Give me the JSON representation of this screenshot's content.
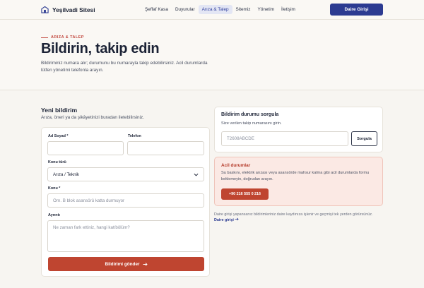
{
  "header": {
    "brand": "Yeşilvadi Sitesi",
    "nav": [
      {
        "label": "Şeffaf Kasa",
        "active": false
      },
      {
        "label": "Duyurular",
        "active": false
      },
      {
        "label": "Arıza & Talep",
        "active": true
      },
      {
        "label": "Sitemiz",
        "active": false
      },
      {
        "label": "Yönetim",
        "active": false
      },
      {
        "label": "İletişim",
        "active": false
      }
    ],
    "login_label": "Daire Girişi"
  },
  "hero": {
    "eyebrow": "ARIZA & TALEP",
    "title": "Bildirin, takip edin",
    "description": "Bildiriminiz numara alır; durumunu bu numarayla takip edebilirsiniz. Acil durumlarda lütfen yönetimi telefonla arayın."
  },
  "form": {
    "title": "Yeni bildirim",
    "subtitle": "Arıza, öneri ya da şikâyetinizi buradan iletebilirsiniz.",
    "name_label": "Ad Soyad *",
    "name_value": "",
    "phone_label": "Telefon",
    "phone_value": "",
    "topic_label": "Konu türü",
    "topic_value": "Arıza / Teknik",
    "subject_label": "Konu *",
    "subject_placeholder": "Örn. B blok asansörü katta durmuyor",
    "details_label": "Ayrıntı",
    "details_placeholder": "Ne zaman fark ettiniz, hangi kat/bölüm?",
    "submit_label": "Bildirimi gönder"
  },
  "tracking": {
    "title": "Bildirim durumu sorgula",
    "subtitle": "Size verilen takip numarasını girin.",
    "placeholder": "T2608ABCDE",
    "button_label": "Sorgula"
  },
  "emergency": {
    "title": "Acil durumlar",
    "text": "Su baskını, elektrik arızası veya asansörde mahsur kalma gibi acil durumlarda formu beklemeyin, doğrudan arayın.",
    "phone": "+90 216 555 0 216"
  },
  "footer_note": {
    "text": "Daire girişi yapansanız bildirimleriniz daire kaydınıza işlenir ve geçmişi tek yerden görürsünüz.",
    "link": "Daire girişi"
  },
  "colors": {
    "accent": "#2c3b91",
    "danger": "#bf4530",
    "background": "#f7f5f1"
  }
}
